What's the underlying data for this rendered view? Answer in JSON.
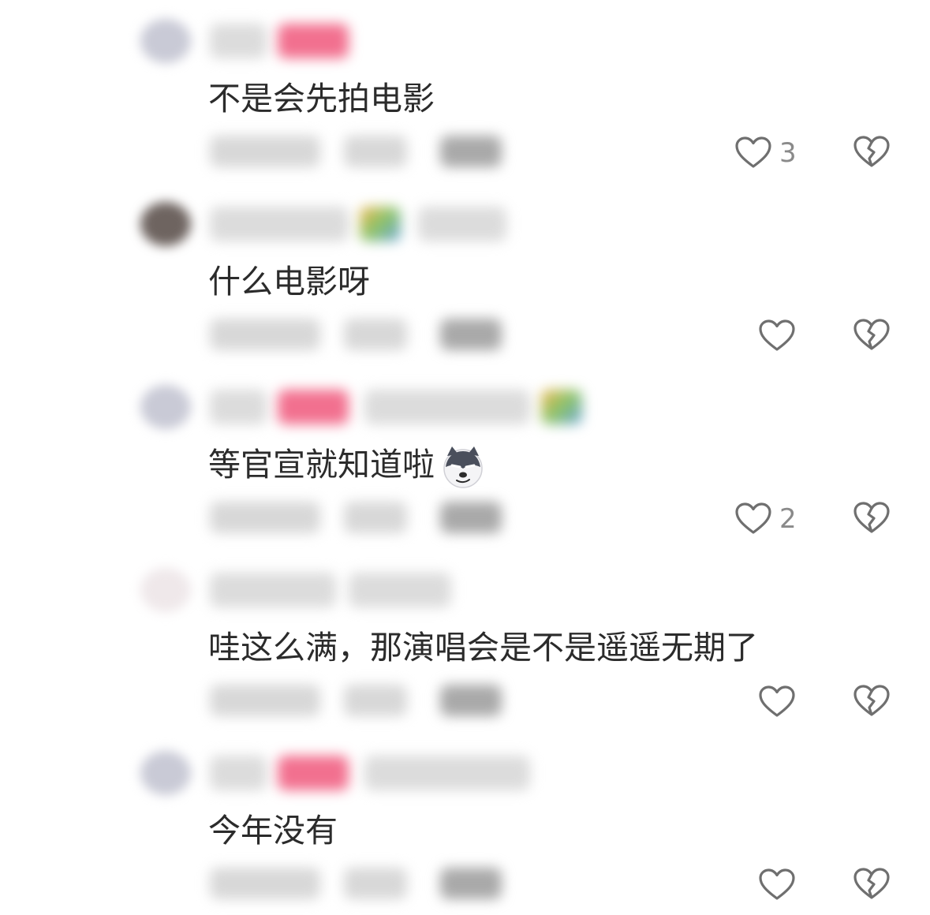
{
  "comments": [
    {
      "text": "不是会先拍电影",
      "like_count": "3",
      "avatar": "gray",
      "has_emoji": false
    },
    {
      "text": "什么电影呀",
      "like_count": "",
      "avatar": "dark",
      "has_emoji": false
    },
    {
      "text": "等官宣就知道啦",
      "like_count": "2",
      "avatar": "gray",
      "has_emoji": true,
      "emoji": "smirking-dog-emoji"
    },
    {
      "text": "哇这么满，那演唱会是不是遥遥无期了",
      "like_count": "",
      "avatar": "light",
      "has_emoji": false
    },
    {
      "text": "今年没有",
      "like_count": "",
      "avatar": "gray",
      "has_emoji": false
    }
  ],
  "icons": {
    "like": "heart-outline-icon",
    "dislike": "broken-heart-icon"
  },
  "colors": {
    "text": "#2b2b2b",
    "icon": "#6f6f6f",
    "count": "#8a8a8a",
    "badge": "#f2708f"
  }
}
